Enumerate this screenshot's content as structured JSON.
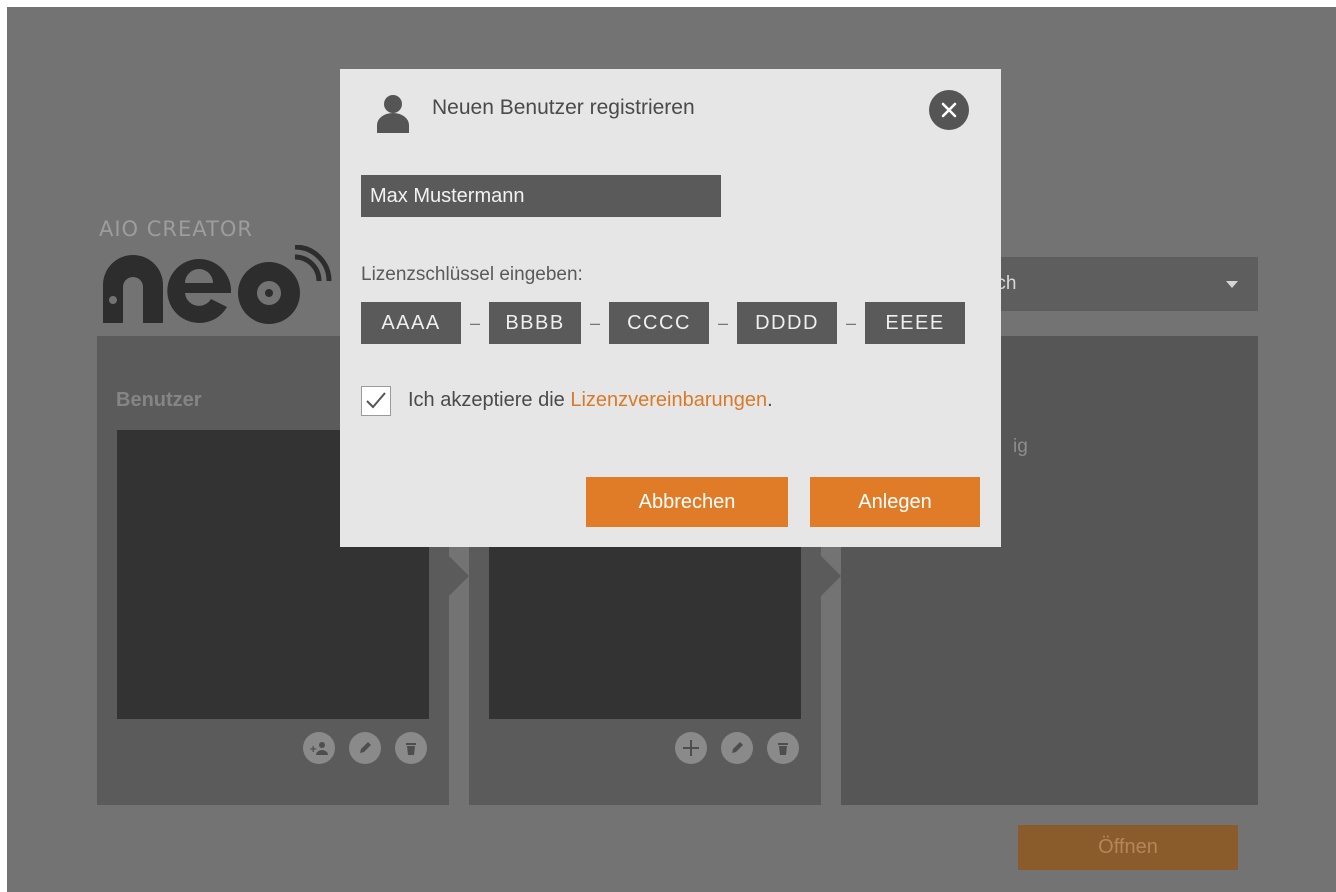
{
  "logo": {
    "small_text": "AIO CREATOR",
    "big_text": "neo"
  },
  "language": {
    "selected": "Deutsch",
    "visible_text": "utsch"
  },
  "panels": {
    "users": {
      "title": "Benutzer",
      "tools": [
        "add-user",
        "edit",
        "delete"
      ]
    },
    "projects": {
      "tools": [
        "add",
        "edit",
        "delete"
      ]
    },
    "info": {
      "ghost_text": "ig"
    }
  },
  "open_button": {
    "label": "Öffnen"
  },
  "dialog": {
    "title": "Neuen Benutzer registrieren",
    "name_value": "Max Mustermann",
    "license_label": "Lizenzschlüssel eingeben:",
    "license_segments": [
      "AAAA",
      "BBBB",
      "CCCC",
      "DDDD",
      "EEEE"
    ],
    "license_separator": "–",
    "accept_prefix": "Ich akzeptiere die ",
    "accept_link": "Lizenzvereinbarungen",
    "accept_suffix": ".",
    "accept_checked": true,
    "cancel_label": "Abbrechen",
    "create_label": "Anlegen"
  },
  "colors": {
    "accent": "#e07c28",
    "overlay_bg": "#737373",
    "dialog_bg": "#e6e6e6"
  }
}
